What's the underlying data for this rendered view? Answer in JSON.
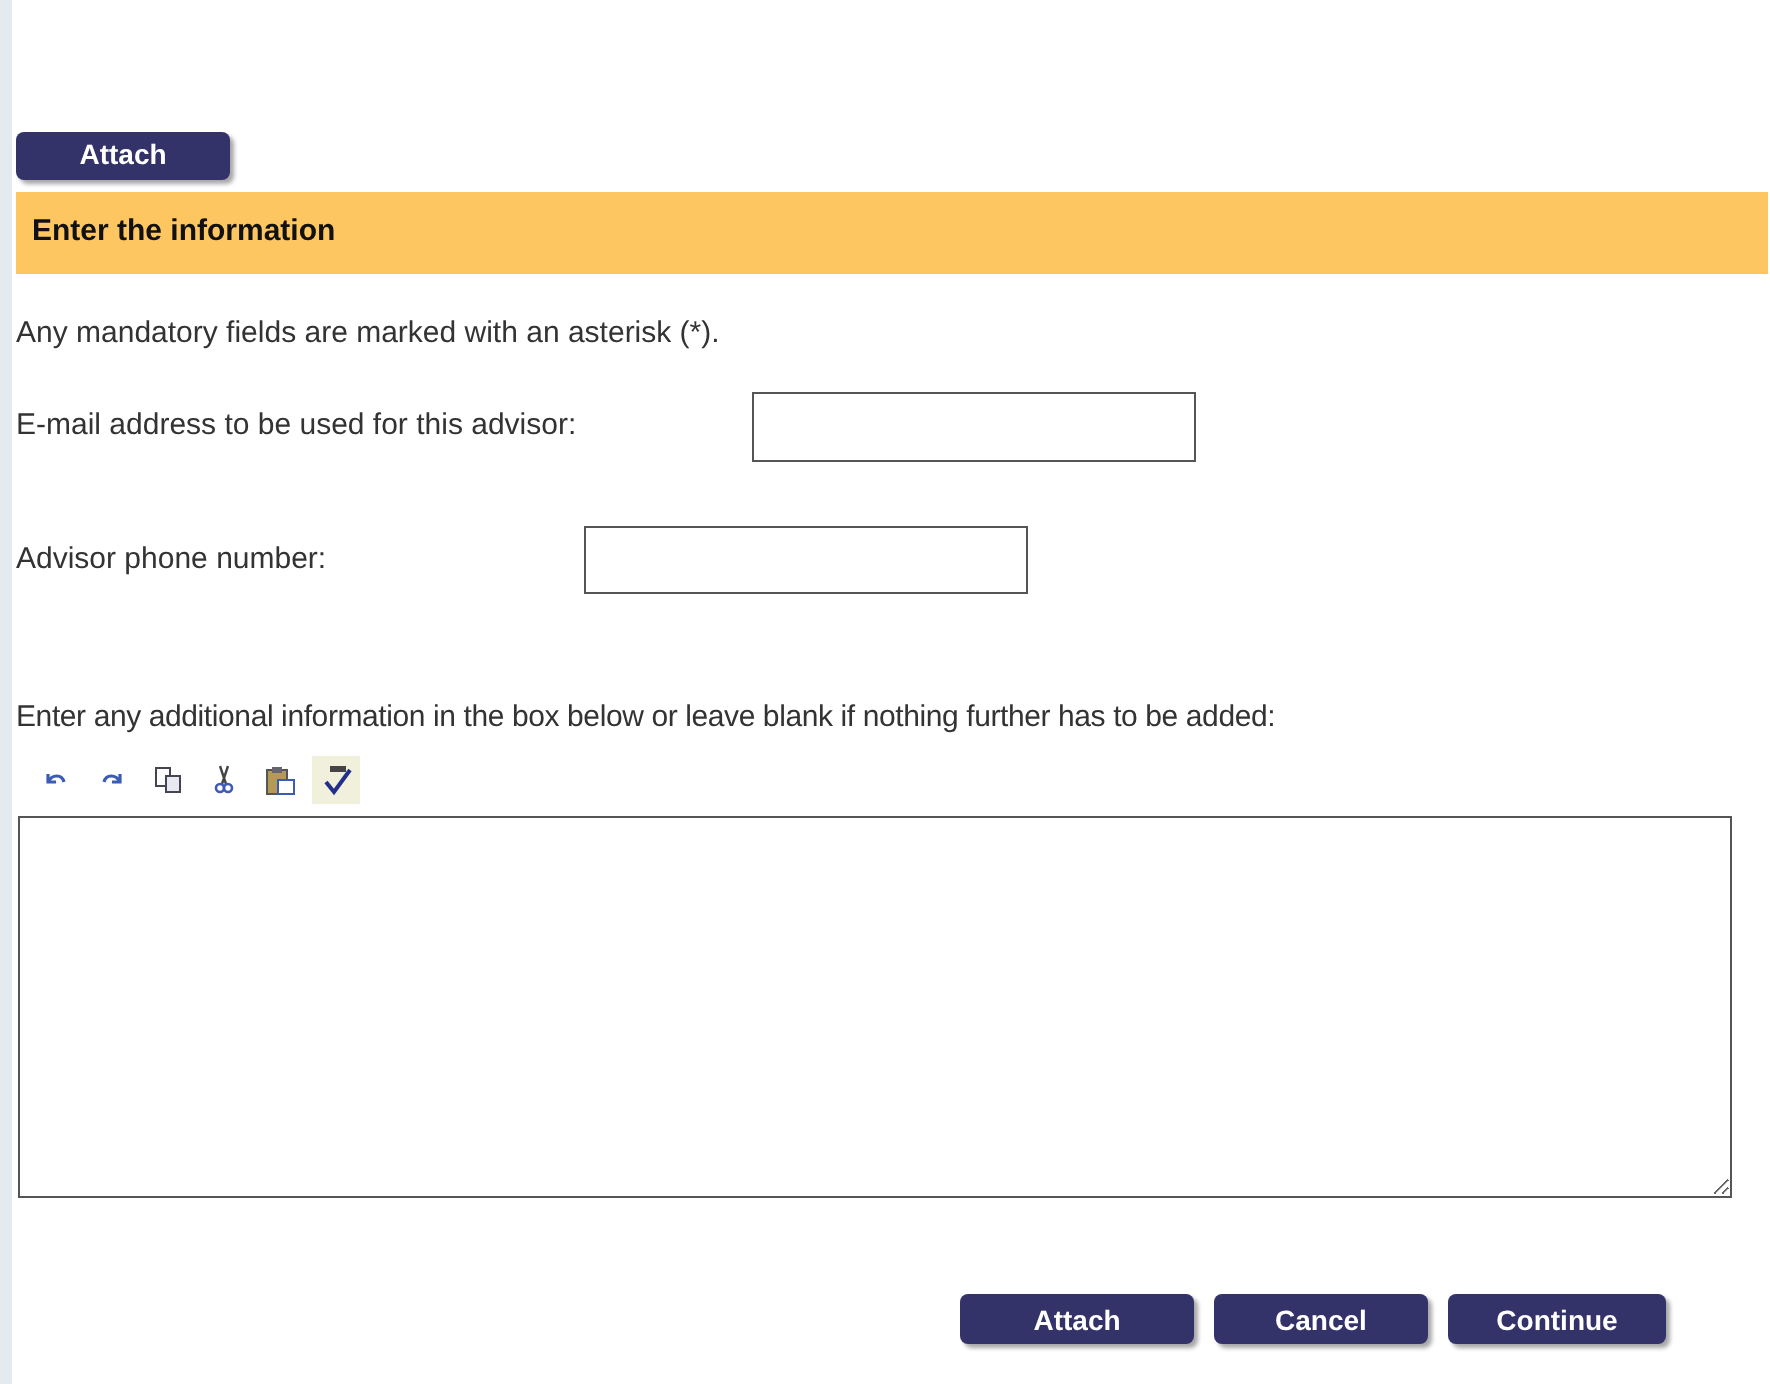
{
  "top_button": "Attach",
  "section_title": "Enter the information",
  "intro": "Any mandatory fields are marked with an asterisk (*).",
  "fields": [
    {
      "label": "E-mail address to be used for this advisor:"
    },
    {
      "label": "Advisor phone number:"
    }
  ],
  "notes_label": "Enter any additional information in the box below or leave blank if nothing further has to be added:",
  "toolbar": [
    {
      "kind": "undo",
      "on": false
    },
    {
      "kind": "redo",
      "on": false
    },
    {
      "kind": "copy",
      "on": false
    },
    {
      "kind": "cut",
      "on": false
    },
    {
      "kind": "paste",
      "on": false
    },
    {
      "kind": "spellcheck",
      "on": true
    }
  ],
  "buttons": [
    "Attach",
    "Cancel",
    "Continue"
  ]
}
